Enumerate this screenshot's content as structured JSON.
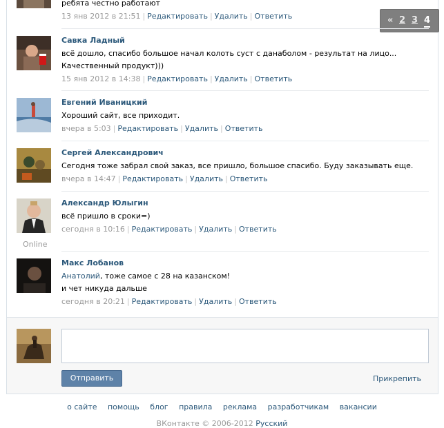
{
  "pager": {
    "prev": "«",
    "pages": [
      "2",
      "3",
      "4"
    ],
    "current": "4"
  },
  "comments": [
    {
      "author": "",
      "text": "ребята честно работают",
      "date": "13 янв 2012 в 21:51",
      "avatar": "user-photo-dark"
    },
    {
      "author": "Савка Ладный",
      "text": "всё дошло, спасибо большое начал колоть суст с данаболом - результат на лицо... Качественный продукт)))",
      "date": "15 янв 2012 в 14:38",
      "avatar": "user-photo-red-cup"
    },
    {
      "author": "Евгений Иваницкий",
      "text": "Хороший сайт, все приходит.",
      "date": "вчера в 5:03",
      "avatar": "user-photo-waterski"
    },
    {
      "author": "Сергей Александрович",
      "text": "Сегодня тоже забрал свой заказ, все пришло, большое спасибо. Буду заказывать еще.",
      "date": "вчера в 14:47",
      "avatar": "user-photo-painting"
    },
    {
      "author": "Александр Юлыгин",
      "text": "всё пришло в сроки=)",
      "date": "сегодня в 10:16",
      "avatar": "user-photo-suit",
      "online": "Online"
    },
    {
      "author": "Макс Лобанов",
      "mention": "Анатолий",
      "text": ", тоже самое с 28 на казанском!",
      "text2": "и чет никуда дальше",
      "date": "сегодня в 20:21",
      "avatar": "user-photo-dark-portrait"
    }
  ],
  "actions": {
    "edit": "Редактировать",
    "delete": "Удалить",
    "reply": "Ответить"
  },
  "reply_form": {
    "send": "Отправить",
    "attach": "Прикрепить",
    "avatar": "user-photo-horseman"
  },
  "footer": {
    "links": [
      "о сайте",
      "помощь",
      "блог",
      "правила",
      "реклама",
      "разработчикам",
      "вакансии"
    ],
    "copyright": "ВКонтакте © 2006-2012",
    "language": "Русский"
  },
  "colors": {
    "link": "#2b587a",
    "button": "#5e82a8",
    "pager": "#7f7f7f"
  }
}
